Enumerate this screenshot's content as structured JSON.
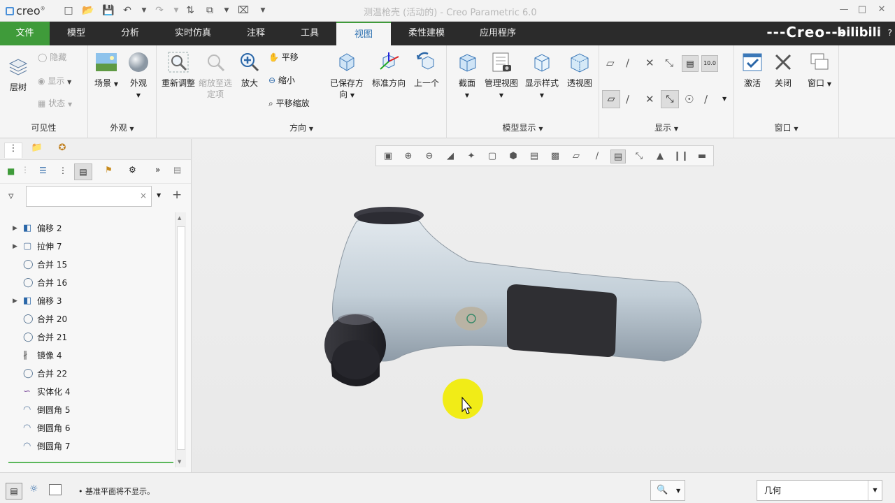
{
  "titlebar": {
    "app_logo": "creo",
    "window_title": "测温枪壳 (活动的) - Creo Parametric 6.0",
    "quick_access": [
      "new-icon",
      "open-icon",
      "save-icon",
      "undo-icon",
      "redo-icon",
      "regenerate-icon",
      "window-icon",
      "close-icon"
    ]
  },
  "tabs": [
    {
      "label": "文件"
    },
    {
      "label": "模型"
    },
    {
      "label": "分析"
    },
    {
      "label": "实时仿真"
    },
    {
      "label": "注释"
    },
    {
      "label": "工具"
    },
    {
      "label": "视图"
    },
    {
      "label": "柔性建模"
    },
    {
      "label": "应用程序"
    }
  ],
  "brand": "---Creo---",
  "watermark": "bilibili",
  "ribbon": {
    "visibility": {
      "label": "可见性",
      "layer_tree": "层树",
      "hide": "隐藏",
      "show": "显示",
      "status": "状态"
    },
    "appearance": {
      "label": "外观",
      "scene": "场景",
      "appearance": "外观"
    },
    "orientation": {
      "label": "方向",
      "refit": "重新调整",
      "zoom_to_selected": "缩放至选定项",
      "zoom_in": "放大",
      "pan": "平移",
      "zoom_out": "缩小",
      "pan_zoom": "平移缩放",
      "saved_orientations": "已保存方向",
      "standard_orientation": "标准方向",
      "previous": "上一个"
    },
    "model_display": {
      "label": "模型显示",
      "section": "截面",
      "manage_views": "管理视图",
      "display_style": "显示样式",
      "perspective_view": "透视图"
    },
    "show": {
      "label": "显示"
    },
    "window": {
      "label": "窗口",
      "activate": "激活",
      "close": "关闭",
      "windows": "窗口"
    }
  },
  "left_panel": {
    "search_placeholder": "",
    "tree_items": [
      {
        "label": "偏移 2",
        "icon": "offset-icon",
        "expandable": true
      },
      {
        "label": "拉伸 7",
        "icon": "extrude-icon",
        "expandable": true
      },
      {
        "label": "合并 15",
        "icon": "merge-icon",
        "expandable": false
      },
      {
        "label": "合并 16",
        "icon": "merge-icon",
        "expandable": false
      },
      {
        "label": "偏移 3",
        "icon": "offset-icon",
        "expandable": true
      },
      {
        "label": "合并 20",
        "icon": "merge-icon",
        "expandable": false
      },
      {
        "label": "合并 21",
        "icon": "merge-icon",
        "expandable": false
      },
      {
        "label": "镜像 4",
        "icon": "mirror-icon",
        "expandable": false
      },
      {
        "label": "合并 22",
        "icon": "merge-icon",
        "expandable": false
      },
      {
        "label": "实体化 4",
        "icon": "solidify-icon",
        "expandable": false
      },
      {
        "label": "倒圆角 5",
        "icon": "round-icon",
        "expandable": false
      },
      {
        "label": "倒圆角 6",
        "icon": "round-icon",
        "expandable": false
      },
      {
        "label": "倒圆角 7",
        "icon": "round-icon",
        "expandable": false
      }
    ]
  },
  "status": {
    "message": "基准平面将不显示。",
    "filter_value": "几何"
  },
  "colors": {
    "file_tab": "#3f9b3a",
    "tab_bar": "#2b2b2b",
    "cursor_highlight": "#f2ec00",
    "model_body": "#c9d4dd",
    "model_dark": "#2f2f33"
  }
}
